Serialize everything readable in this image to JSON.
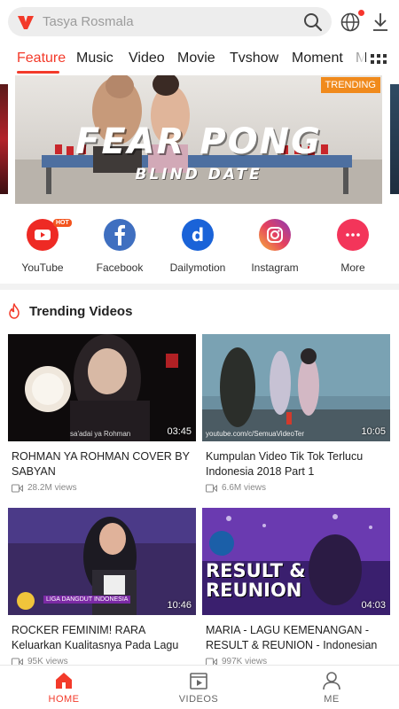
{
  "header": {
    "search_placeholder": "Tasya Rosmala"
  },
  "tabs": [
    {
      "label": "Feature",
      "active": true
    },
    {
      "label": "Music"
    },
    {
      "label": "Video"
    },
    {
      "label": "Movie"
    },
    {
      "label": "Tvshow"
    },
    {
      "label": "Moment"
    },
    {
      "label": "M"
    }
  ],
  "banner": {
    "badge": "TRENDING",
    "title": "FEAR PONG",
    "subtitle": "BLIND DATE"
  },
  "sites": [
    {
      "label": "YouTube",
      "badge": "HOT",
      "color": "#ee2a24",
      "icon": "youtube-icon"
    },
    {
      "label": "Facebook",
      "color": "#3f6fc0",
      "icon": "facebook-icon"
    },
    {
      "label": "Dailymotion",
      "color": "#1a63d8",
      "icon": "dailymotion-icon"
    },
    {
      "label": "Instagram",
      "color": "#d62f7b",
      "icon": "instagram-icon"
    },
    {
      "label": "More",
      "color": "#f3355a",
      "icon": "more-dots-icon"
    }
  ],
  "trending": {
    "title": "Trending Videos",
    "videos": [
      {
        "title": "ROHMAN YA ROHMAN COVER BY SABYAN",
        "views": "28.2M views",
        "duration": "03:45",
        "caption": "sa'adai ya Rohman"
      },
      {
        "title": "Kumpulan Video Tik Tok Terlucu Indonesia 2018 Part 1",
        "views": "6.6M views",
        "duration": "10:05",
        "caption": "youtube.com/c/SemuaVideoTer"
      },
      {
        "title": "ROCKER FEMINIM! RARA Keluarkan Kualitasnya Pada Lagu",
        "views": "95K views",
        "duration": "10:46",
        "caption": "LIGA DANGDUT INDONESIA"
      },
      {
        "title": "MARIA - LAGU KEMENANGAN - RESULT & REUNION - Indonesian",
        "views": "997K views",
        "duration": "04:03",
        "caption": "RESULT & REUNION"
      }
    ]
  },
  "nav": [
    {
      "label": "HOME",
      "active": true
    },
    {
      "label": "VIDEOS"
    },
    {
      "label": "ME"
    }
  ],
  "colors": {
    "accent": "#f33a2a",
    "trending_badge": "#f08a1c"
  }
}
